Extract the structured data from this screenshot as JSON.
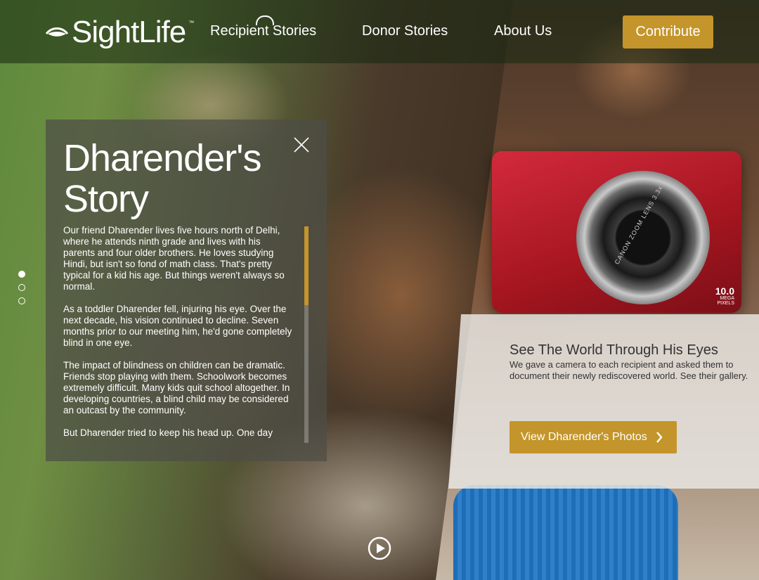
{
  "brand": {
    "name": "SightLife",
    "trademark": "™"
  },
  "nav": {
    "items": [
      {
        "label": "Recipient Stories"
      },
      {
        "label": "Donor Stories"
      },
      {
        "label": "About Us"
      }
    ],
    "contribute_label": "Contribute"
  },
  "story": {
    "title_line1": "Dharender's",
    "title_line2": "Story",
    "paragraphs": [
      "Our friend Dharender lives five hours north of Delhi, where he attends ninth grade and lives with his parents and four older brothers. He loves studying Hindi, but isn't so fond of math class. That's pretty typical for a kid his age. But things weren't always so normal.",
      "As a toddler Dharender fell, injuring his eye. Over the next decade, his vision continued to decline. Seven months prior to our meeting him, he'd gone completely blind in one eye.",
      "The impact of blindness on children can be dramatic. Friends stop playing with them. Schoolwork becomes extremely difficult. Many kids quit school altogether. In developing countries, a blind child may be considered an outcast by the community.",
      "But Dharender tried to keep his head up. One day"
    ]
  },
  "slides": {
    "count": 3,
    "active_index": 0
  },
  "promo": {
    "heading": "See The World Through His Eyes",
    "text": "We gave a camera to each recipient and asked them to document their newly rediscovered world. See their gallery.",
    "button_label": "View Dharender's Photos"
  },
  "camera_badge": {
    "megapixels": "10.0",
    "unit_line1": "MEGA",
    "unit_line2": "PIXELS",
    "lens_text": "CANON ZOOM LENS 3.3x"
  },
  "colors": {
    "accent": "#c4952a",
    "header_bg": "rgba(22,40,16,.55)",
    "panel_bg": "rgba(78,78,70,.72)"
  },
  "icons": {
    "logo": "eye-logo-icon",
    "close": "close-icon",
    "chevron": "chevron-right-icon",
    "play": "play-icon"
  }
}
